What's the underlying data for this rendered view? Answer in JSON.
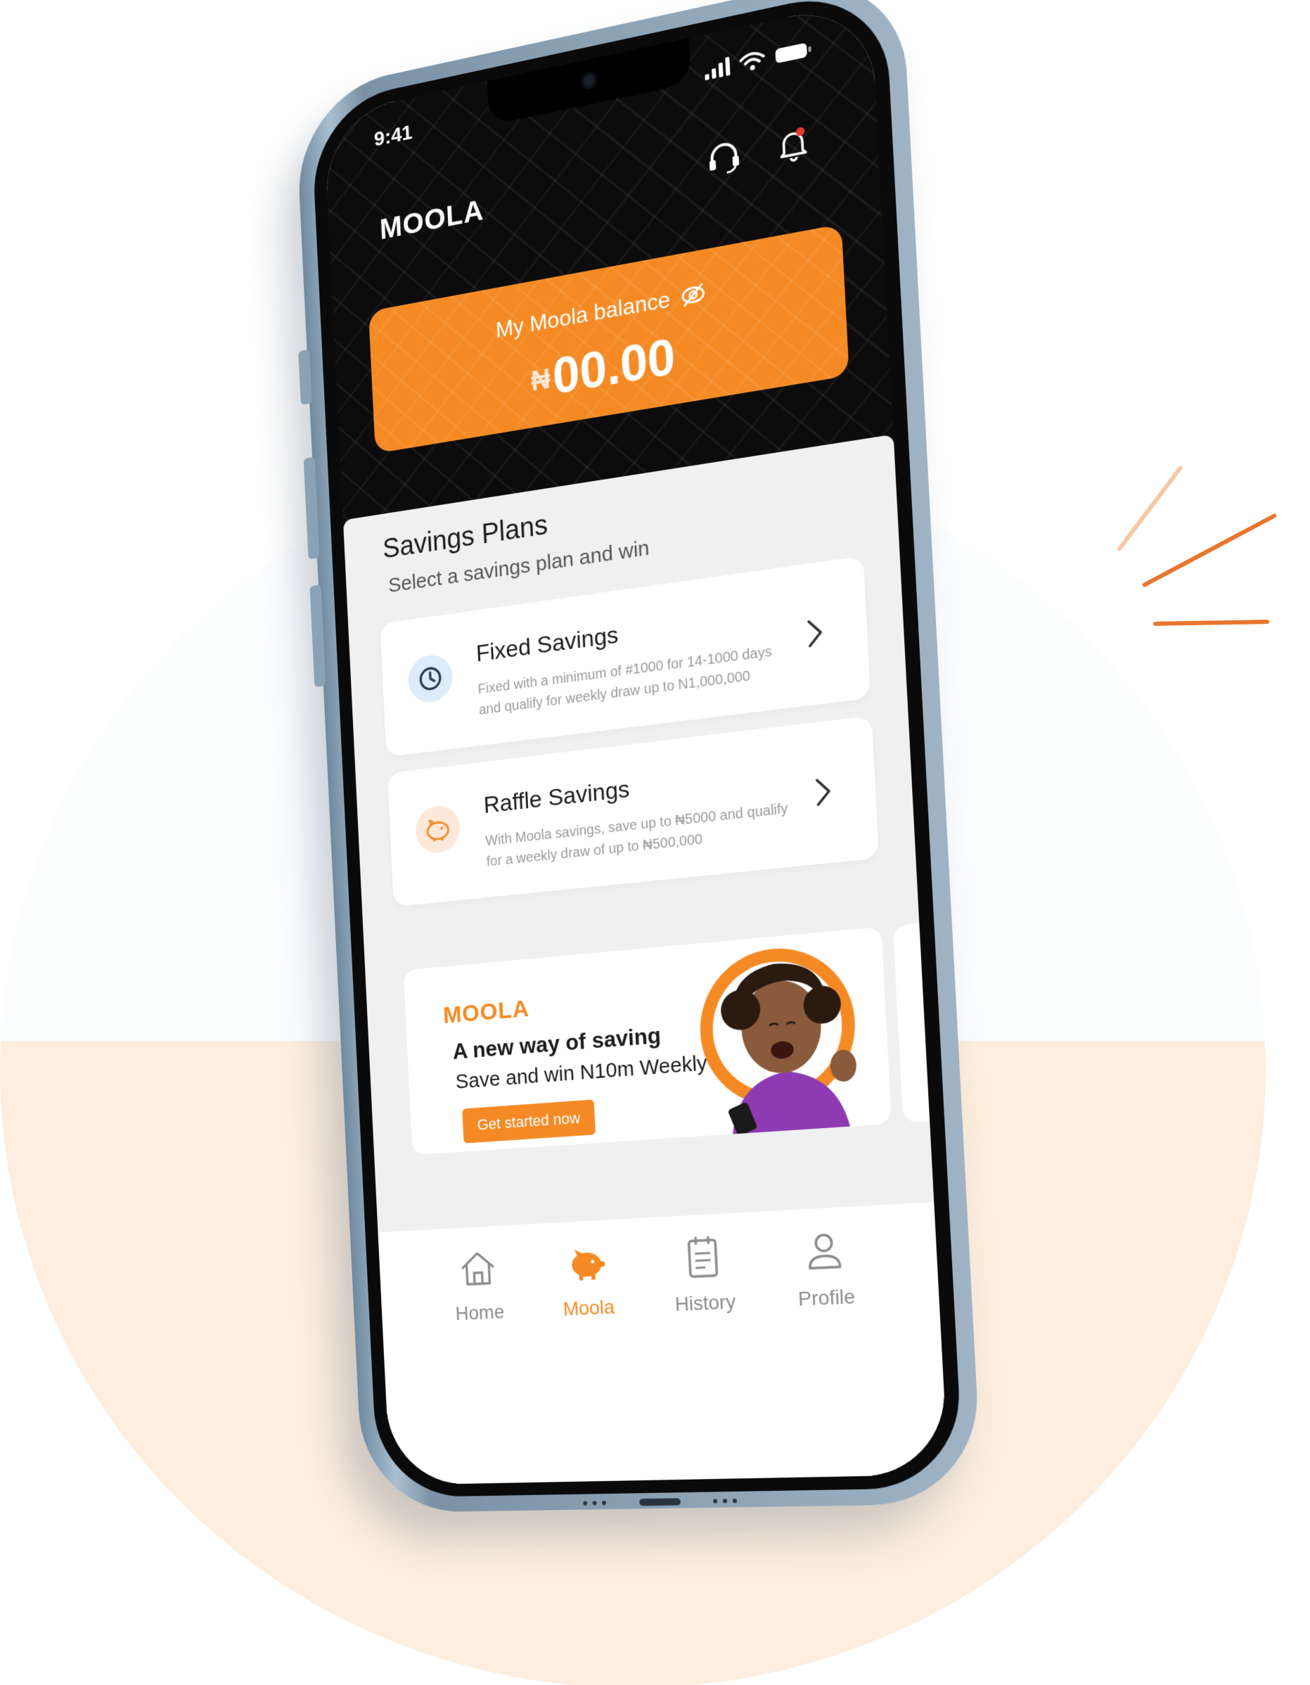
{
  "status_bar": {
    "time": "9:41"
  },
  "header": {
    "app_title": "MOOLA",
    "support_icon": "headset-icon",
    "notification_icon": "bell-icon"
  },
  "balance": {
    "label": "My Moola balance",
    "currency_symbol": "₦",
    "amount": "00.00",
    "visibility_icon": "eye-off-icon"
  },
  "savings": {
    "title": "Savings Plans",
    "subtitle": "Select a savings plan and win",
    "plans": [
      {
        "title": "Fixed Savings",
        "description": "Fixed with a minimum of #1000 for 14-1000 days and qualify for weekly draw up to N1,000,000",
        "icon": "clock-icon"
      },
      {
        "title": "Raffle Savings",
        "description": "With Moola savings, save up to ₦5000 and qualify for a weekly draw of up to ₦500,000",
        "icon": "piggy-bank-icon"
      }
    ]
  },
  "promo": {
    "brand": "MOOLA",
    "headline": "A new way of saving",
    "subline": "Save and win N10m Weekly",
    "cta_label": "Get started now"
  },
  "bottom_nav": {
    "items": [
      {
        "label": "Home",
        "icon": "home-icon",
        "active": false
      },
      {
        "label": "Moola",
        "icon": "piggy-bank-icon",
        "active": true
      },
      {
        "label": "History",
        "icon": "clipboard-icon",
        "active": false
      },
      {
        "label": "Profile",
        "icon": "user-icon",
        "active": false
      }
    ]
  },
  "colors": {
    "accent": "#F58A24",
    "header_bg": "#0c0c0c",
    "body_bg": "#f0f0f0",
    "card_bg": "#ffffff",
    "nav_inactive": "#8c8c8c",
    "background_peach": "#FDEEDF"
  }
}
